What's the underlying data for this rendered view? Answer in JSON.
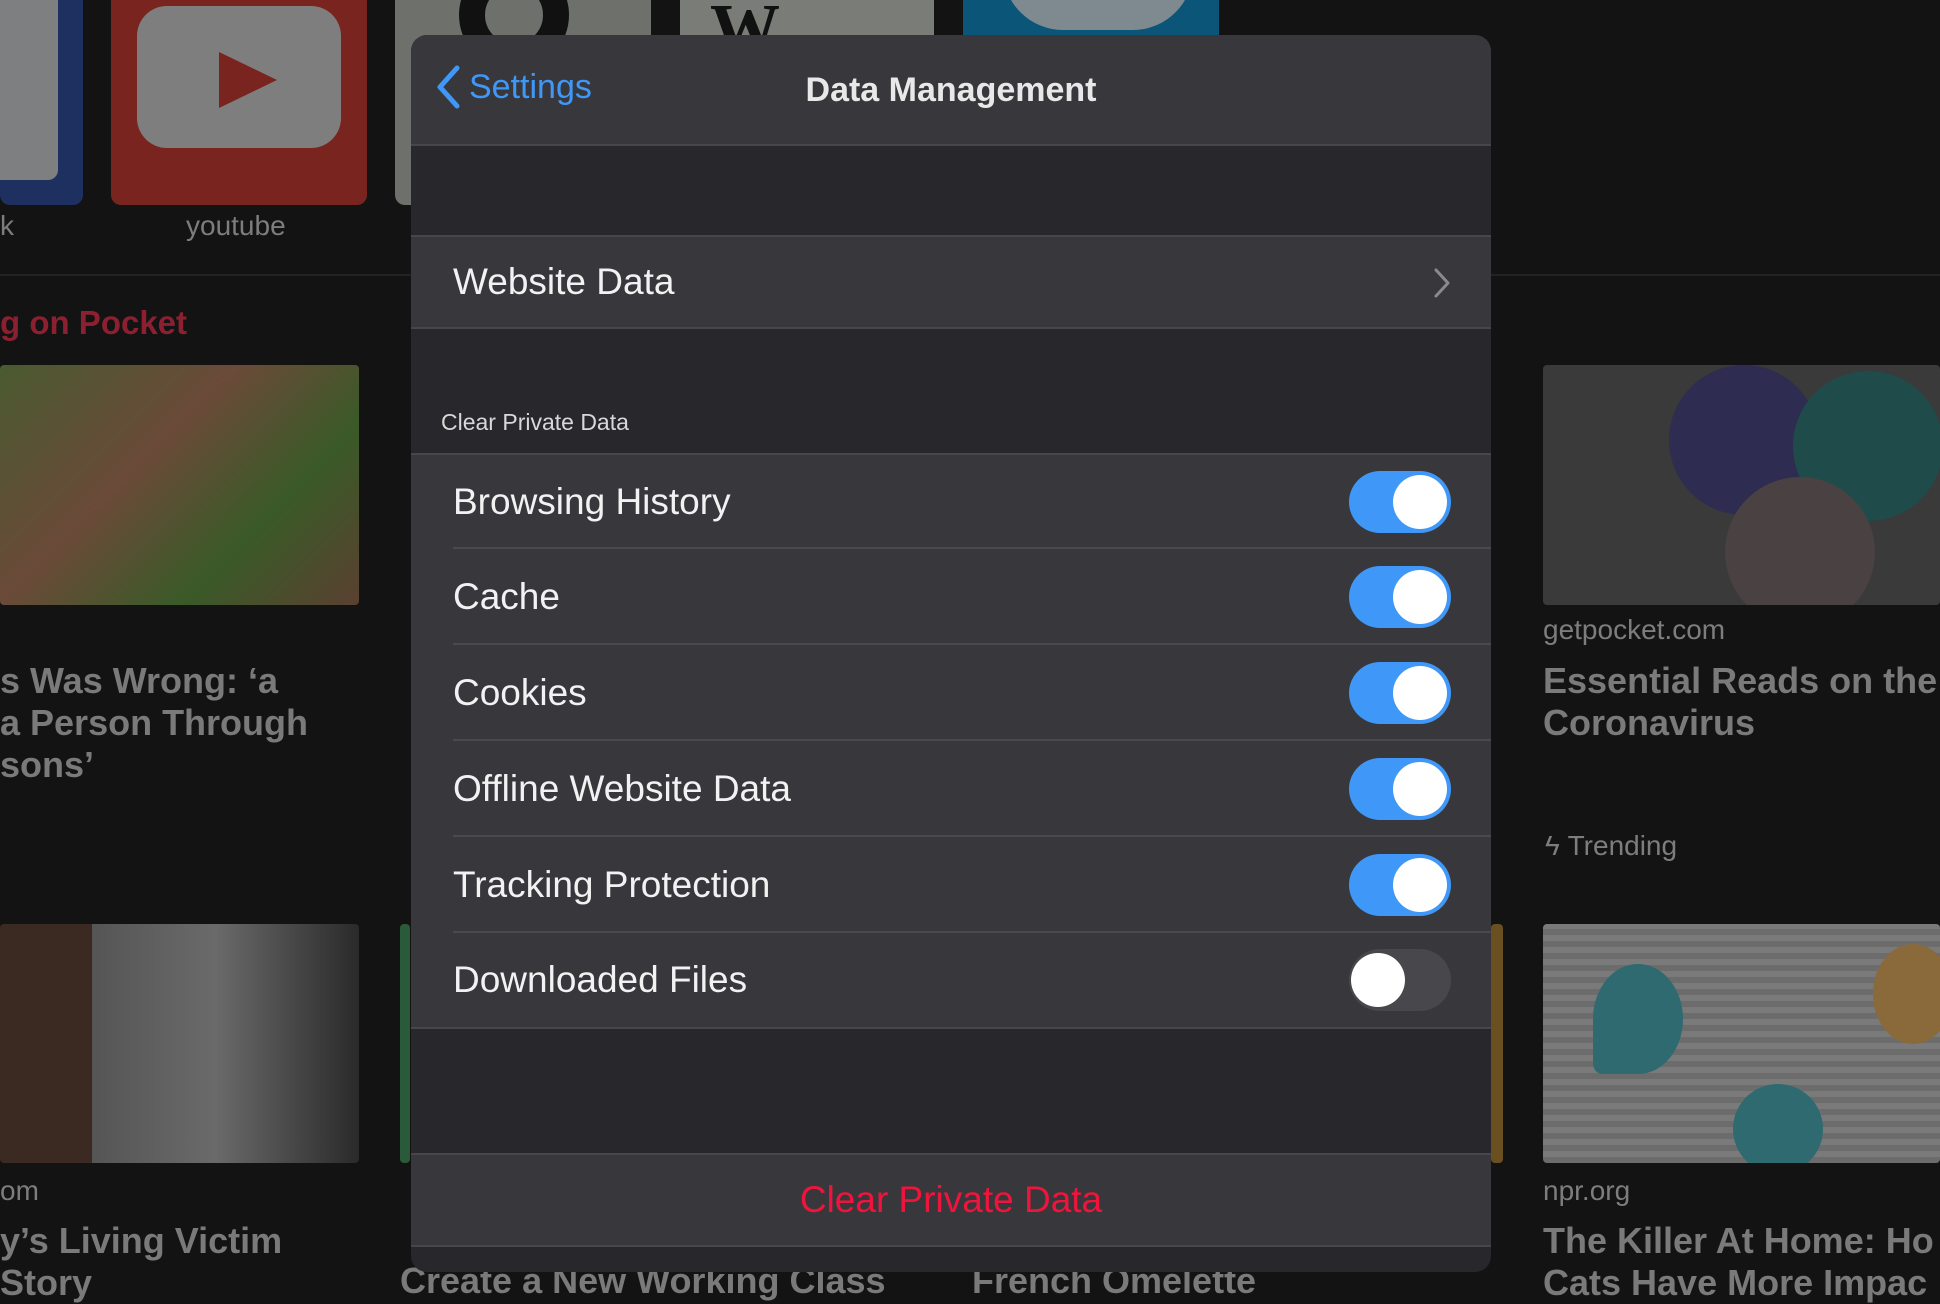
{
  "background": {
    "top_sites": [
      {
        "label": "k",
        "icon": "facebook-icon",
        "color": "#1e3060"
      },
      {
        "label": "youtube",
        "icon": "youtube-icon",
        "color": "#7a2420"
      },
      {
        "label": "",
        "icon": "site-icon",
        "color": "#6e706c"
      },
      {
        "label": "",
        "icon": "wikipedia-icon",
        "color": "#7a7c78"
      },
      {
        "label": "",
        "icon": "twitter-icon",
        "color": "#0b5578"
      }
    ],
    "section_title": "g on Pocket",
    "section_title_color": "#8c2030",
    "cards": [
      {
        "title_lines": [
          "s Was Wrong: ‘a",
          "a Person Through",
          "sons’"
        ]
      },
      {
        "source": "getpocket.com",
        "title_lines": [
          "Essential Reads on the",
          "Coronavirus"
        ],
        "tag": "Trending"
      },
      {
        "source": "om",
        "title_lines": [
          "y’s Living Victim",
          "Story"
        ]
      },
      {
        "title_lines": [
          "Create a New Working Class"
        ]
      },
      {
        "title_lines": [
          "French Omelette"
        ]
      },
      {
        "source": "npr.org",
        "title_lines": [
          "The Killer At Home: Ho",
          "Cats Have More Impac"
        ]
      }
    ]
  },
  "modal": {
    "back_label": "Settings",
    "title": "Data Management",
    "website_data_label": "Website Data",
    "section_header": "Clear Private Data",
    "items": [
      {
        "label": "Browsing History",
        "enabled": true
      },
      {
        "label": "Cache",
        "enabled": true
      },
      {
        "label": "Cookies",
        "enabled": true
      },
      {
        "label": "Offline Website Data",
        "enabled": true
      },
      {
        "label": "Tracking Protection",
        "enabled": true
      },
      {
        "label": "Downloaded Files",
        "enabled": false
      }
    ],
    "clear_button_label": "Clear Private Data",
    "accent_color": "#3f98f8",
    "destructive_color": "#f0143c"
  }
}
